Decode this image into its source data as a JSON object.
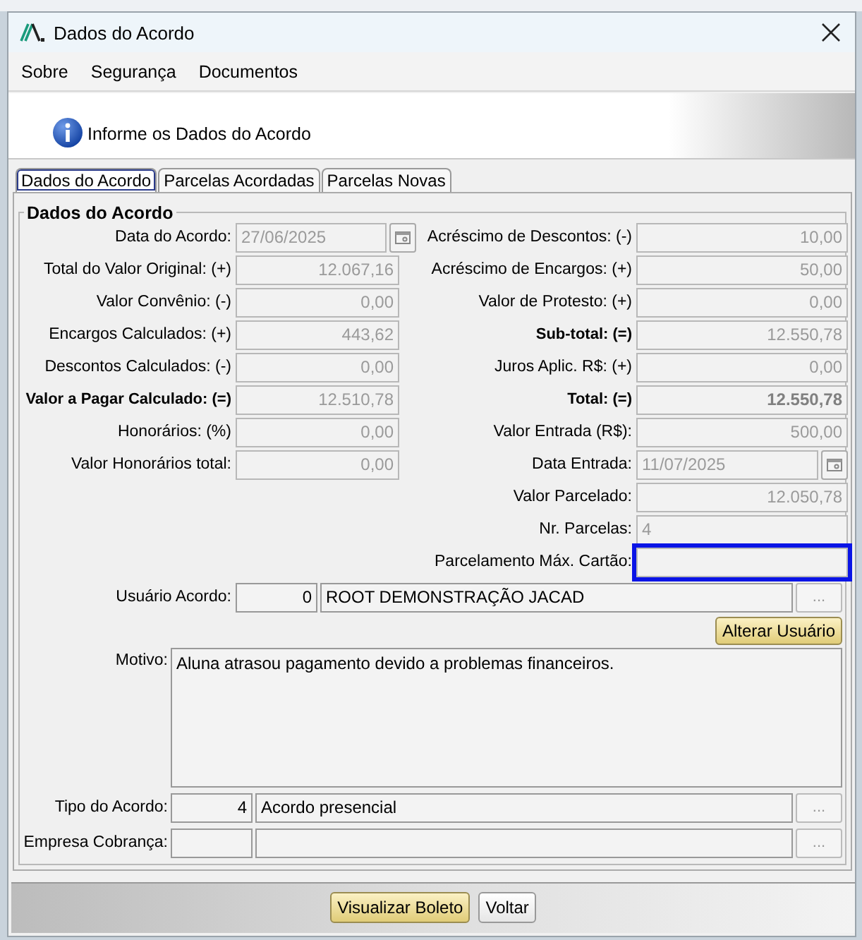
{
  "window": {
    "title": "Dados do Acordo"
  },
  "menu": [
    "Sobre",
    "Segurança",
    "Documentos"
  ],
  "header": {
    "text": "Informe os Dados do Acordo"
  },
  "tabs": [
    {
      "label": "Dados do Acordo",
      "selected": true
    },
    {
      "label": "Parcelas Acordadas",
      "selected": false
    },
    {
      "label": "Parcelas Novas",
      "selected": false
    }
  ],
  "group": {
    "title": "Dados do Acordo"
  },
  "left_fields": [
    {
      "label": "Data do Acordo:",
      "value": "27/06/2025",
      "kind": "date",
      "bold": false,
      "value_bold": false,
      "disabled": true
    },
    {
      "label": "Total do Valor Original: (+)",
      "value": "12.067,16",
      "kind": "number",
      "bold": false,
      "value_bold": false,
      "disabled": true
    },
    {
      "label": "Valor Convênio: (-)",
      "value": "0,00",
      "kind": "number",
      "bold": false,
      "value_bold": false,
      "disabled": true
    },
    {
      "label": "Encargos Calculados: (+)",
      "value": "443,62",
      "kind": "number",
      "bold": false,
      "value_bold": false,
      "disabled": true
    },
    {
      "label": "Descontos Calculados: (-)",
      "value": "0,00",
      "kind": "number",
      "bold": false,
      "value_bold": false,
      "disabled": true
    },
    {
      "label": "Valor a Pagar Calculado: (=)",
      "value": "12.510,78",
      "kind": "number",
      "bold": true,
      "value_bold": false,
      "disabled": true
    },
    {
      "label": "Honorários: (%)",
      "value": "0,00",
      "kind": "number",
      "bold": false,
      "value_bold": false,
      "disabled": true
    },
    {
      "label": "Valor Honorários total:",
      "value": "0,00",
      "kind": "number",
      "bold": false,
      "value_bold": false,
      "disabled": true
    }
  ],
  "right_fields": [
    {
      "label": "Acréscimo de Descontos: (-)",
      "value": "10,00",
      "kind": "number",
      "bold": false,
      "value_bold": false,
      "disabled": true,
      "highlighted": false
    },
    {
      "label": "Acréscimo de Encargos: (+)",
      "value": "50,00",
      "kind": "number",
      "bold": false,
      "value_bold": false,
      "disabled": true,
      "highlighted": false
    },
    {
      "label": "Valor de Protesto: (+)",
      "value": "0,00",
      "kind": "number",
      "bold": false,
      "value_bold": false,
      "disabled": true,
      "highlighted": false
    },
    {
      "label": "Sub-total: (=)",
      "value": "12.550,78",
      "kind": "number",
      "bold": true,
      "value_bold": false,
      "disabled": true,
      "highlighted": false
    },
    {
      "label": "Juros Aplic. R$: (+)",
      "value": "0,00",
      "kind": "number",
      "bold": false,
      "value_bold": false,
      "disabled": true,
      "highlighted": false
    },
    {
      "label": "Total: (=)",
      "value": "12.550,78",
      "kind": "number",
      "bold": true,
      "value_bold": true,
      "disabled": true,
      "highlighted": false
    },
    {
      "label": "Valor Entrada (R$):",
      "value": "500,00",
      "kind": "number",
      "bold": false,
      "value_bold": false,
      "disabled": true,
      "highlighted": false
    },
    {
      "label": "Data Entrada:",
      "value": "11/07/2025",
      "kind": "date",
      "bold": false,
      "value_bold": false,
      "disabled": true,
      "highlighted": false
    },
    {
      "label": "Valor Parcelado:",
      "value": "12.050,78",
      "kind": "number",
      "bold": false,
      "value_bold": false,
      "disabled": true,
      "highlighted": false
    },
    {
      "label": "Nr. Parcelas:",
      "value": "4",
      "kind": "text",
      "bold": false,
      "value_bold": false,
      "disabled": true,
      "highlighted": false
    },
    {
      "label": "Parcelamento Máx. Cartão:",
      "kind": "text",
      "bold": false,
      "value_bold": false,
      "disabled": true,
      "highlighted": true
    }
  ],
  "usuario": {
    "label": "Usuário Acordo:",
    "code": "0",
    "name": "ROOT DEMONSTRAÇÃO JACAD",
    "button": "...",
    "action": "Alterar Usuário"
  },
  "motivo": {
    "label": "Motivo:",
    "value": "Aluna atrasou pagamento devido a problemas financeiros."
  },
  "lookups": [
    {
      "label": "Tipo do Acordo:",
      "code": "4",
      "name": "Acordo presencial",
      "button": "..."
    },
    {
      "label": "Empresa Cobrança:",
      "button": "..."
    }
  ],
  "footer_buttons": [
    {
      "label": "Visualizar Boleto",
      "primary": true
    },
    {
      "label": "Voltar",
      "primary": false
    }
  ]
}
